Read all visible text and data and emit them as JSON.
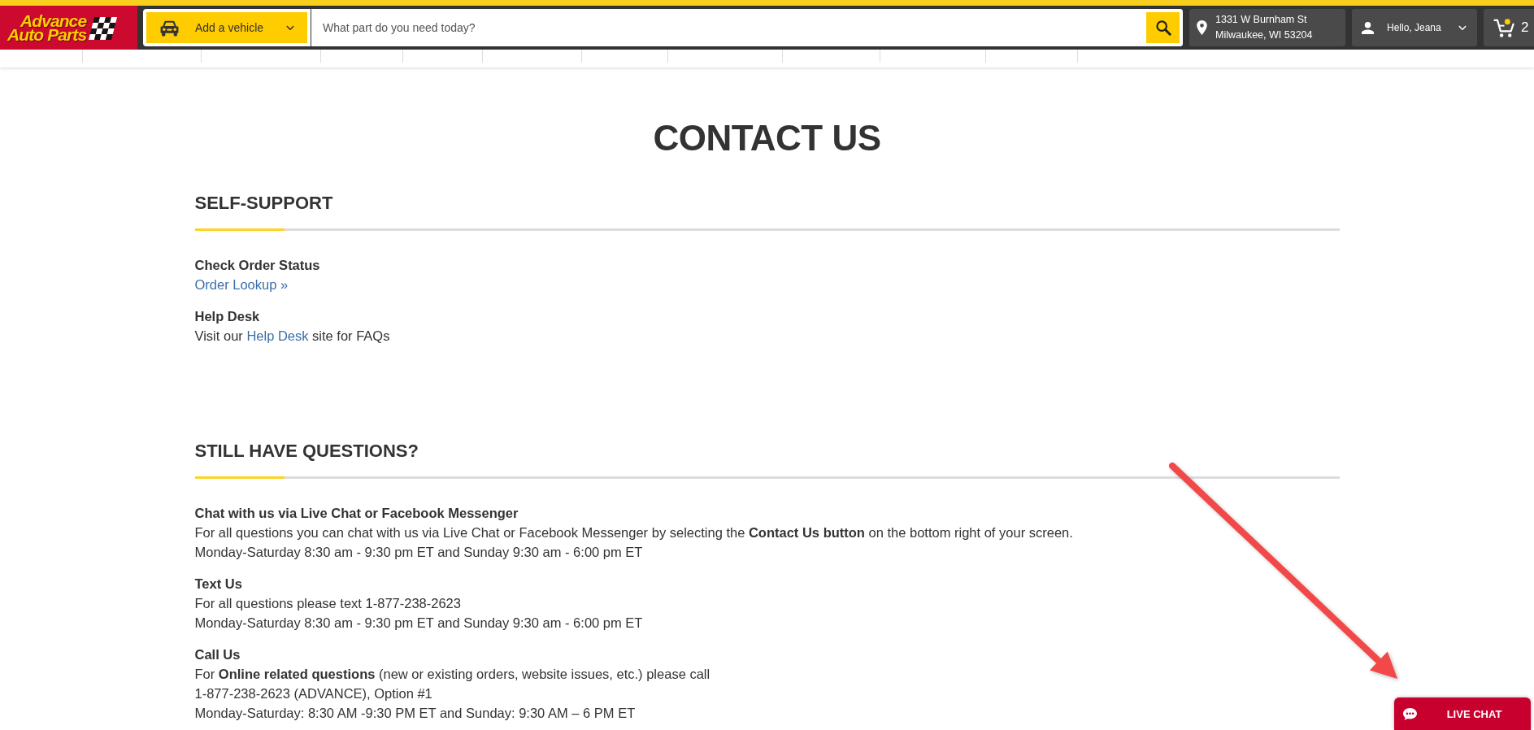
{
  "header": {
    "logo": {
      "lines": [
        "Advance",
        "Auto Parts"
      ]
    },
    "vehicle_button": {
      "label": "Add a vehicle"
    },
    "search": {
      "placeholder": "What part do you need today?"
    },
    "location": {
      "lines": [
        "1331 W Burnham St",
        "Milwaukee, WI 53204"
      ]
    },
    "account": {
      "label": "Hello, Jeana"
    },
    "cart": {
      "count": "2"
    }
  },
  "page_title": "CONTACT US",
  "sections": [
    {
      "heading": "SELF-SUPPORT",
      "items": [
        {
          "title": "Check Order Status",
          "lines": [
            {
              "parts": [
                {
                  "kind": "link",
                  "text": "Order Lookup »"
                }
              ]
            }
          ]
        },
        {
          "title": "Help Desk",
          "lines": [
            {
              "parts": [
                {
                  "kind": "text",
                  "text": "Visit our "
                },
                {
                  "kind": "link",
                  "text": "Help Desk"
                },
                {
                  "kind": "text",
                  "text": " site for FAQs"
                }
              ]
            }
          ]
        }
      ]
    },
    {
      "heading": "STILL HAVE QUESTIONS?",
      "items": [
        {
          "title": "Chat with us via Live Chat or Facebook Messenger",
          "lines": [
            {
              "parts": [
                {
                  "kind": "text",
                  "text": "For all questions you can chat with us via Live Chat or Facebook Messenger by selecting the **Contact Us button** on the bottom right of your screen."
                }
              ]
            },
            {
              "parts": [
                {
                  "kind": "text",
                  "text": "Monday-Saturday 8:30 am - 9:30 pm ET and Sunday 9:30 am - 6:00 pm ET"
                }
              ]
            }
          ]
        },
        {
          "title": "Text Us",
          "lines": [
            {
              "parts": [
                {
                  "kind": "text",
                  "text": "For all questions please text 1-877-238-2623"
                }
              ]
            },
            {
              "parts": [
                {
                  "kind": "text",
                  "text": "Monday-Saturday 8:30 am - 9:30 pm ET and Sunday 9:30 am - 6:00 pm ET"
                }
              ]
            }
          ]
        },
        {
          "title": "Call Us",
          "lines": [
            {
              "parts": [
                {
                  "kind": "text",
                  "text": "For **Online related questions** (new or existing orders, website issues, etc.) please call"
                }
              ]
            },
            {
              "parts": [
                {
                  "kind": "text",
                  "text": "1-877-238-2623 (ADVANCE), Option #1"
                }
              ]
            },
            {
              "parts": [
                {
                  "kind": "text",
                  "text": "Monday-Saturday: 8:30 AM -9:30 PM ET and Sunday: 9:30 AM – 6 PM ET"
                }
              ]
            }
          ]
        }
      ]
    }
  ],
  "live_chat_button": {
    "label": "LIVE CHAT"
  }
}
